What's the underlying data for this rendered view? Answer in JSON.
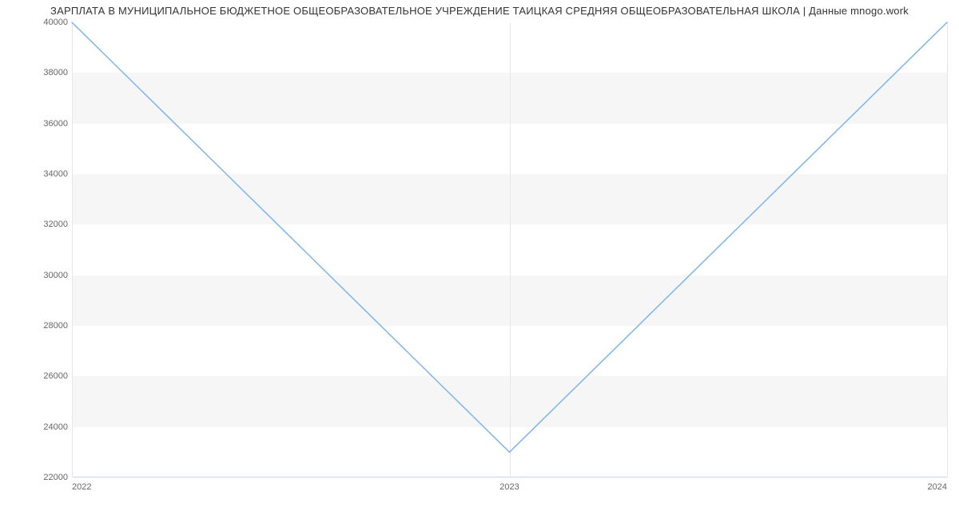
{
  "chart_data": {
    "type": "line",
    "title": "ЗАРПЛАТА В МУНИЦИПАЛЬНОЕ БЮДЖЕТНОЕ ОБЩЕОБРАЗОВАТЕЛЬНОЕ УЧРЕЖДЕНИЕ ТАИЦКАЯ СРЕДНЯЯ ОБЩЕОБРАЗОВАТЕЛЬНАЯ ШКОЛА | Данные mnogo.work",
    "x": [
      2022,
      2023,
      2024
    ],
    "values": [
      40000,
      23000,
      40000
    ],
    "xlabel": "",
    "ylabel": "",
    "ylim": [
      22000,
      40000
    ],
    "y_ticks": [
      22000,
      24000,
      26000,
      28000,
      30000,
      32000,
      34000,
      36000,
      38000,
      40000
    ],
    "x_ticks": [
      2022,
      2023,
      2024
    ],
    "line_color": "#7cb5ec"
  }
}
